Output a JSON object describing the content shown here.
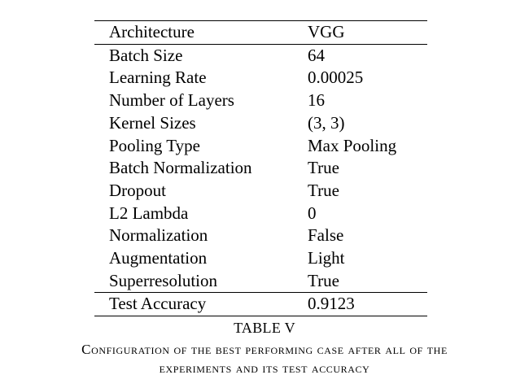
{
  "table": {
    "header": {
      "key": "Architecture",
      "value": "VGG"
    },
    "rows": [
      {
        "key": "Batch Size",
        "value": "64"
      },
      {
        "key": "Learning Rate",
        "value": "0.00025"
      },
      {
        "key": "Number of Layers",
        "value": "16"
      },
      {
        "key": "Kernel Sizes",
        "value": "(3, 3)"
      },
      {
        "key": "Pooling Type",
        "value": "Max Pooling"
      },
      {
        "key": "Batch Normalization",
        "value": "True"
      },
      {
        "key": "Dropout",
        "value": "True"
      },
      {
        "key": "L2 Lambda",
        "value": "0"
      },
      {
        "key": "Normalization",
        "value": "False"
      },
      {
        "key": "Augmentation",
        "value": "Light"
      },
      {
        "key": "Superresolution",
        "value": "True"
      }
    ],
    "footer": {
      "key": "Test Accuracy",
      "value": "0.9123"
    }
  },
  "caption": {
    "label": "TABLE V",
    "line1": "Configuration of the best performing case after all of the",
    "line2": "experiments and its test accuracy"
  }
}
